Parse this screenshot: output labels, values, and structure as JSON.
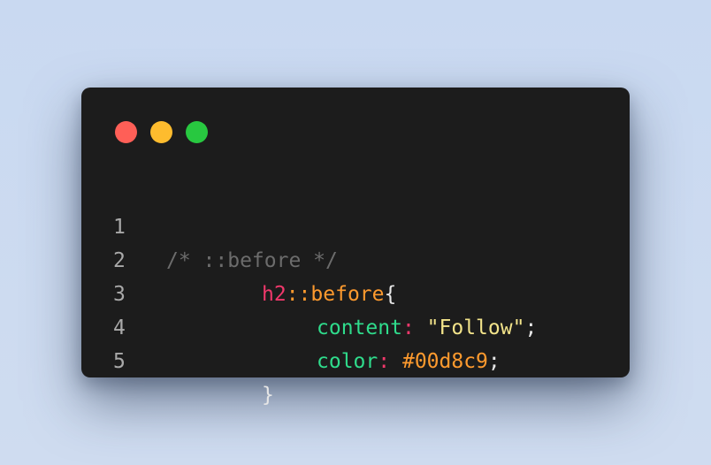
{
  "window": {
    "controls": [
      "close",
      "minimize",
      "maximize"
    ]
  },
  "code": {
    "line_numbers": [
      "1",
      "2",
      "3",
      "4",
      "5"
    ],
    "line1": {
      "comment": "/* ::before */"
    },
    "line2": {
      "selector": "h2",
      "pseudo": "::before",
      "open_brace": "{"
    },
    "line3": {
      "property": "content",
      "colon": ":",
      "value": "\"Follow\"",
      "semicolon": ";"
    },
    "line4": {
      "property": "color",
      "colon": ":",
      "value": "#00d8c9",
      "semicolon": ";"
    },
    "line5": {
      "close_brace": "}"
    }
  },
  "colors": {
    "background": "#cddbf0",
    "editor": "#1c1c1c",
    "close": "#ff5f57",
    "minimize": "#febc2e",
    "maximize": "#28c840",
    "comment": "#6c6c6c",
    "selector": "#f0386b",
    "pseudo": "#fe9a2e",
    "property": "#2fdc8c",
    "string": "#f2e38a"
  }
}
